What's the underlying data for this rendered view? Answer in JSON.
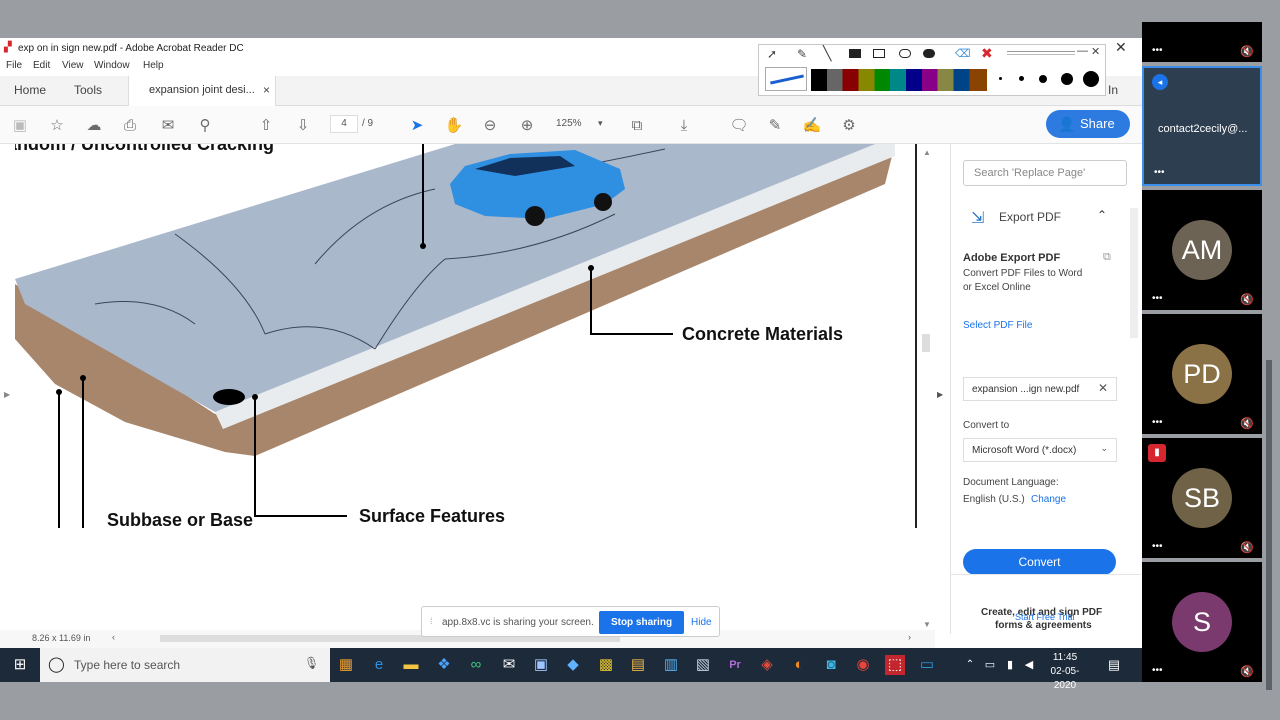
{
  "window": {
    "title": "exp      on  in  sign new.pdf - Adobe Acrobat Reader DC",
    "menu": [
      "File",
      "Edit",
      "View",
      "Window",
      "Help"
    ],
    "tabs": {
      "home": "Home",
      "tools": "Tools",
      "document": "expansion joint desi..."
    },
    "page_current": "4",
    "page_total": "/ 9",
    "zoom": "125%",
    "share_label": "Share",
    "signin_partial": "In"
  },
  "document": {
    "heading_partial": "andom / Uncontrolled Cracking",
    "labels": {
      "concrete": "Concrete Materials",
      "surface": "Surface Features",
      "subbase": "Subbase or Base"
    },
    "page_size": "8.26 x 11.69 in"
  },
  "right_pane": {
    "search_placeholder": "Search 'Replace Page'",
    "export_title": "Export PDF",
    "service_title": "Adobe Export PDF",
    "service_desc_line1": "Convert PDF Files to Word",
    "service_desc_line2": "or Excel Online",
    "select_file_label": "Select PDF File",
    "file_name": "expansion ...ign new.pdf",
    "convert_to_label": "Convert to",
    "convert_format": "Microsoft Word (*.docx)",
    "language_label": "Document Language:",
    "language_value": "English (U.S.)",
    "change_link": "Change",
    "convert_button": "Convert",
    "promo_line1": "Create, edit and sign PDF",
    "promo_line2": "forms & agreements",
    "trial_link": "Start Free Trial"
  },
  "share_bar": {
    "message": "app.8x8.vc is sharing your screen.",
    "stop": "Stop sharing",
    "hide": "Hide"
  },
  "taskbar": {
    "search_placeholder": "Type here to search",
    "time": "11:45",
    "date": "02-05-2020"
  },
  "participants": [
    {
      "initials": "",
      "name": "contact2cecily@...",
      "color": "#2d3e50"
    },
    {
      "initials": "AM",
      "color": "#6d6354"
    },
    {
      "initials": "PD",
      "color": "#8a7146"
    },
    {
      "initials": "SB",
      "color": "#706246"
    },
    {
      "initials": "S",
      "color": "#7a3a6e"
    }
  ],
  "colors": {
    "accent": "#1a73e8",
    "share_button": "#2d7be0",
    "acrobat_red": "#d8262e",
    "car_blue": "#2f8fe0"
  }
}
